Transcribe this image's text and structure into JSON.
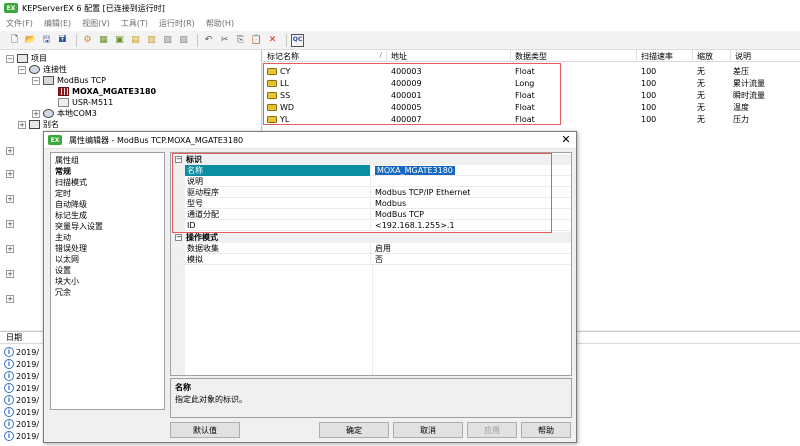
{
  "window": {
    "app_icon": "EX",
    "title": "KEPServerEX 6 配置 [已连接到运行时]"
  },
  "menu": [
    "文件(F)",
    "编辑(E)",
    "视图(V)",
    "工具(T)",
    "运行时(R)",
    "帮助(H)"
  ],
  "toolbar": {
    "icons": [
      "new-file-icon",
      "open-folder-icon",
      "save-icon",
      "save-as-icon",
      "gear-icon",
      "new-channel-icon",
      "new-device-icon",
      "new-tag-icon",
      "tag-group-icon",
      "bulk-tag-icon",
      "properties-icon",
      "undo-icon",
      "cut-icon",
      "copy-icon",
      "paste-icon",
      "delete-icon",
      "quick-client-icon"
    ],
    "glyphs": [
      "🗋",
      "📂",
      "🖫",
      "🖬",
      "⚙",
      "▦",
      "▣",
      "▤",
      "▥",
      "▧",
      "▨",
      "↶",
      "✂",
      "⎘",
      "📋",
      "✕",
      "QC"
    ]
  },
  "tree": {
    "project": "项目",
    "connectivity": "连接性",
    "channel": "ModBus TCP",
    "device_selected": "MOXA_MGATE3180",
    "device_2": "USR-M511",
    "com": "本地COM3",
    "alias": "别名",
    "expand_minus": "−",
    "expand_plus": "+"
  },
  "tags": {
    "columns": [
      "标记名称",
      "地址",
      "数据类型",
      "扫描速率",
      "缩放",
      "说明"
    ],
    "sort_glyph": "/",
    "rows": [
      {
        "name": "CY",
        "address": "400003",
        "type": "Float",
        "rate": "100",
        "scaling": "无",
        "desc": "差压"
      },
      {
        "name": "LL",
        "address": "400009",
        "type": "Long",
        "rate": "100",
        "scaling": "无",
        "desc": "累计流量"
      },
      {
        "name": "SS",
        "address": "400001",
        "type": "Float",
        "rate": "100",
        "scaling": "无",
        "desc": "瞬时流量"
      },
      {
        "name": "WD",
        "address": "400005",
        "type": "Float",
        "rate": "100",
        "scaling": "无",
        "desc": "温度"
      },
      {
        "name": "YL",
        "address": "400007",
        "type": "Float",
        "rate": "100",
        "scaling": "无",
        "desc": "压力"
      }
    ]
  },
  "log": {
    "column": "日期",
    "rows": [
      "2019/",
      "2019/",
      "2019/",
      "2019/",
      "2019/",
      "2019/",
      "2019/",
      "2019/",
      "2019/"
    ]
  },
  "dialog": {
    "icon": "EX",
    "title": "属性编辑器 - ModBus TCP.MOXA_MGATE3180",
    "close": "✕",
    "categories_header": "属性组",
    "categories": [
      "常规",
      "扫描模式",
      "定时",
      "自动降级",
      "标记生成",
      "突量导入设置",
      "主动",
      "错误处理",
      "以太网",
      "设置",
      "块大小",
      "冗余"
    ],
    "group_identity": "标识",
    "group_operation": "操作模式",
    "group_toggle": "−",
    "identity_props": [
      {
        "name": "名称",
        "value": "MOXA_MGATE3180"
      },
      {
        "name": "说明",
        "value": ""
      },
      {
        "name": "驱动程序",
        "value": "Modbus TCP/IP Ethernet"
      },
      {
        "name": "型号",
        "value": "Modbus"
      },
      {
        "name": "通道分配",
        "value": "ModBus TCP"
      },
      {
        "name": "ID",
        "value": "<192.168.1.255>.1"
      }
    ],
    "operation_props": [
      {
        "name": "数据收集",
        "value": "启用"
      },
      {
        "name": "模拟",
        "value": "否"
      }
    ],
    "description_title": "名称",
    "description_text": "指定此对象的标识。",
    "buttons": {
      "defaults": "默认值",
      "ok": "确定",
      "cancel": "取消",
      "apply": "应用",
      "help": "帮助"
    }
  },
  "colors": {
    "selection": "#0a8ea0",
    "highlight_border": "#e35b5b"
  }
}
